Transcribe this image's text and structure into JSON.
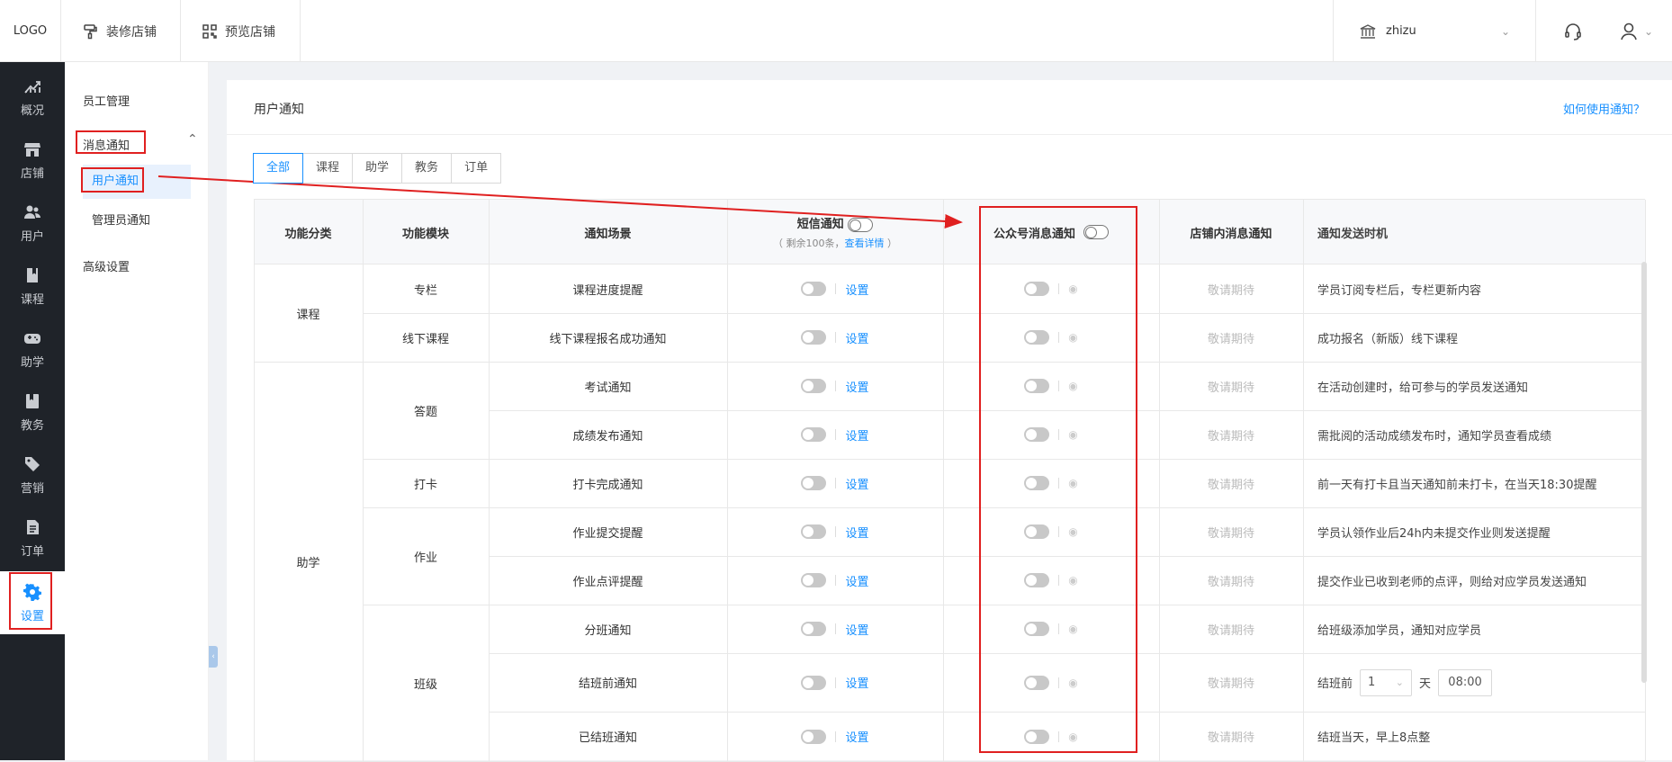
{
  "topbar": {
    "logo": "LOGO",
    "decorate_label": "装修店铺",
    "preview_label": "预览店铺",
    "shop_name": "zhizu"
  },
  "leftnav": {
    "items": [
      {
        "label": "概况",
        "icon": "chart-up-icon"
      },
      {
        "label": "店铺",
        "icon": "store-icon"
      },
      {
        "label": "用户",
        "icon": "users-icon"
      },
      {
        "label": "课程",
        "icon": "book-icon"
      },
      {
        "label": "助学",
        "icon": "gamepad-icon"
      },
      {
        "label": "教务",
        "icon": "bookmark-icon"
      },
      {
        "label": "营销",
        "icon": "tag-icon"
      },
      {
        "label": "订单",
        "icon": "document-icon"
      },
      {
        "label": "设置",
        "icon": "gear-icon"
      }
    ]
  },
  "submenu": {
    "staff": "员工管理",
    "message": "消息通知",
    "user_notify": "用户通知",
    "admin_notify": "管理员通知",
    "advanced": "高级设置"
  },
  "card": {
    "title": "用户通知",
    "help_link": "如何使用通知？"
  },
  "tabs": [
    "全部",
    "课程",
    "助学",
    "教务",
    "订单"
  ],
  "table": {
    "headers": {
      "category": "功能分类",
      "module": "功能模块",
      "scene": "通知场景",
      "sms": "短信通知",
      "sms_note_prefix": "（ 剩余100条，",
      "sms_note_link": "查看详情",
      "sms_note_suffix": " ）",
      "wechat": "公众号消息通知",
      "in_shop": "店铺内消息通知",
      "timing": "通知发送时机"
    },
    "set_label": "设置",
    "coming_soon": "敬请期待",
    "categories": [
      "课程",
      "助学"
    ],
    "modules": [
      "专栏",
      "线下课程",
      "答题",
      "打卡",
      "作业",
      "班级"
    ],
    "rows": [
      {
        "scene": "课程进度提醒",
        "timing": "学员订阅专栏后，专栏更新内容"
      },
      {
        "scene": "线下课程报名成功通知",
        "timing": "成功报名（新版）线下课程"
      },
      {
        "scene": "考试通知",
        "timing": "在活动创建时，给可参与的学员发送通知"
      },
      {
        "scene": "成绩发布通知",
        "timing": "需批阅的活动成绩发布时，通知学员查看成绩"
      },
      {
        "scene": "打卡完成通知",
        "timing": "前一天有打卡且当天通知前未打卡，在当天18:30提醒"
      },
      {
        "scene": "作业提交提醒",
        "timing": "学员认领作业后24h内未提交作业则发送提醒"
      },
      {
        "scene": "作业点评提醒",
        "timing": "提交作业已收到老师的点评，则给对应学员发送通知"
      },
      {
        "scene": "分班通知",
        "timing": "给班级添加学员，通知对应学员"
      },
      {
        "scene": "结班前通知",
        "timing_prefix": "结班前",
        "days_value": "1",
        "days_unit": "天",
        "time_value": "08:00"
      },
      {
        "scene": "已结班通知",
        "timing": "结班当天，早上8点整"
      }
    ]
  },
  "colors": {
    "accent": "#1890ff",
    "annotation": "#e02020",
    "nav_bg": "#1f2329"
  }
}
